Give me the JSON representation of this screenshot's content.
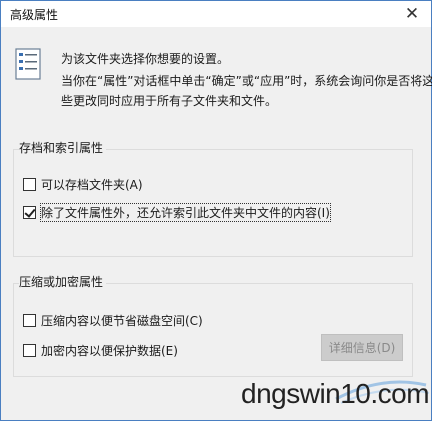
{
  "window": {
    "title": "高级属性",
    "close_glyph": "✕"
  },
  "intro": {
    "line1": "为该文件夹选择你想要的设置。",
    "line2": "当你在“属性”对话框中单击“确定”或“应用”时，系统会询问你是否将这",
    "line3": "些更改同时应用于所有子文件夹和文件。"
  },
  "archive_group": {
    "label": "存档和索引属性",
    "options": [
      {
        "label": "可以存档文件夹(A)",
        "checked": false
      },
      {
        "label": "除了文件属性外，还允许索引此文件夹中文件的内容(I)",
        "checked": true
      }
    ]
  },
  "compress_group": {
    "label": "压缩或加密属性",
    "options": [
      {
        "label": "压缩内容以便节省磁盘空间(C)",
        "checked": false
      },
      {
        "label": "加密内容以便保护数据(E)",
        "checked": false
      }
    ],
    "details_button": "详细信息(D)"
  },
  "watermark": {
    "text": "dngswin10.com"
  },
  "colors": {
    "dialog_bg": "#f0f0f0",
    "titlebar_bg": "#ffffff",
    "border_accent": "#4a7fc1",
    "disabled_button_bg": "#cccccc",
    "disabled_text": "#8a8a8a"
  }
}
